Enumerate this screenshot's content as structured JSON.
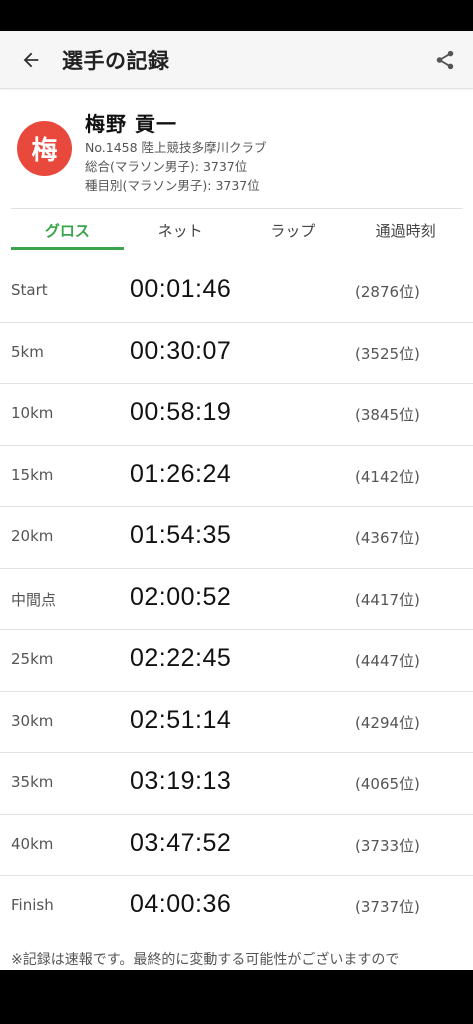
{
  "header": {
    "title": "選手の記録"
  },
  "icons": {
    "back": "arrow-back-icon",
    "share": "share-icon"
  },
  "colors": {
    "accent": "#3aa54a",
    "avatar": "#e8493c"
  },
  "profile": {
    "avatar_char": "梅",
    "name": "梅野 貢一",
    "number_club": "No.1458 陸上競技多摩川クラブ",
    "overall_rank": "総合(マラソン男子): 3737位",
    "category_rank": "種目別(マラソン男子): 3737位"
  },
  "tabs": [
    {
      "label": "グロス",
      "active": true
    },
    {
      "label": "ネット",
      "active": false
    },
    {
      "label": "ラップ",
      "active": false
    },
    {
      "label": "通過時刻",
      "active": false
    }
  ],
  "splits": [
    {
      "label": "Start",
      "time": "00:01:46",
      "rank": "(2876位)"
    },
    {
      "label": "5km",
      "time": "00:30:07",
      "rank": "(3525位)"
    },
    {
      "label": "10km",
      "time": "00:58:19",
      "rank": "(3845位)"
    },
    {
      "label": "15km",
      "time": "01:26:24",
      "rank": "(4142位)"
    },
    {
      "label": "20km",
      "time": "01:54:35",
      "rank": "(4367位)"
    },
    {
      "label": "中間点",
      "time": "02:00:52",
      "rank": "(4417位)"
    },
    {
      "label": "25km",
      "time": "02:22:45",
      "rank": "(4447位)"
    },
    {
      "label": "30km",
      "time": "02:51:14",
      "rank": "(4294位)"
    },
    {
      "label": "35km",
      "time": "03:19:13",
      "rank": "(4065位)"
    },
    {
      "label": "40km",
      "time": "03:47:52",
      "rank": "(3733位)"
    },
    {
      "label": "Finish",
      "time": "04:00:36",
      "rank": "(3737位)"
    }
  ],
  "footer_note": "※記録は速報です。最終的に変動する可能性がございますので"
}
